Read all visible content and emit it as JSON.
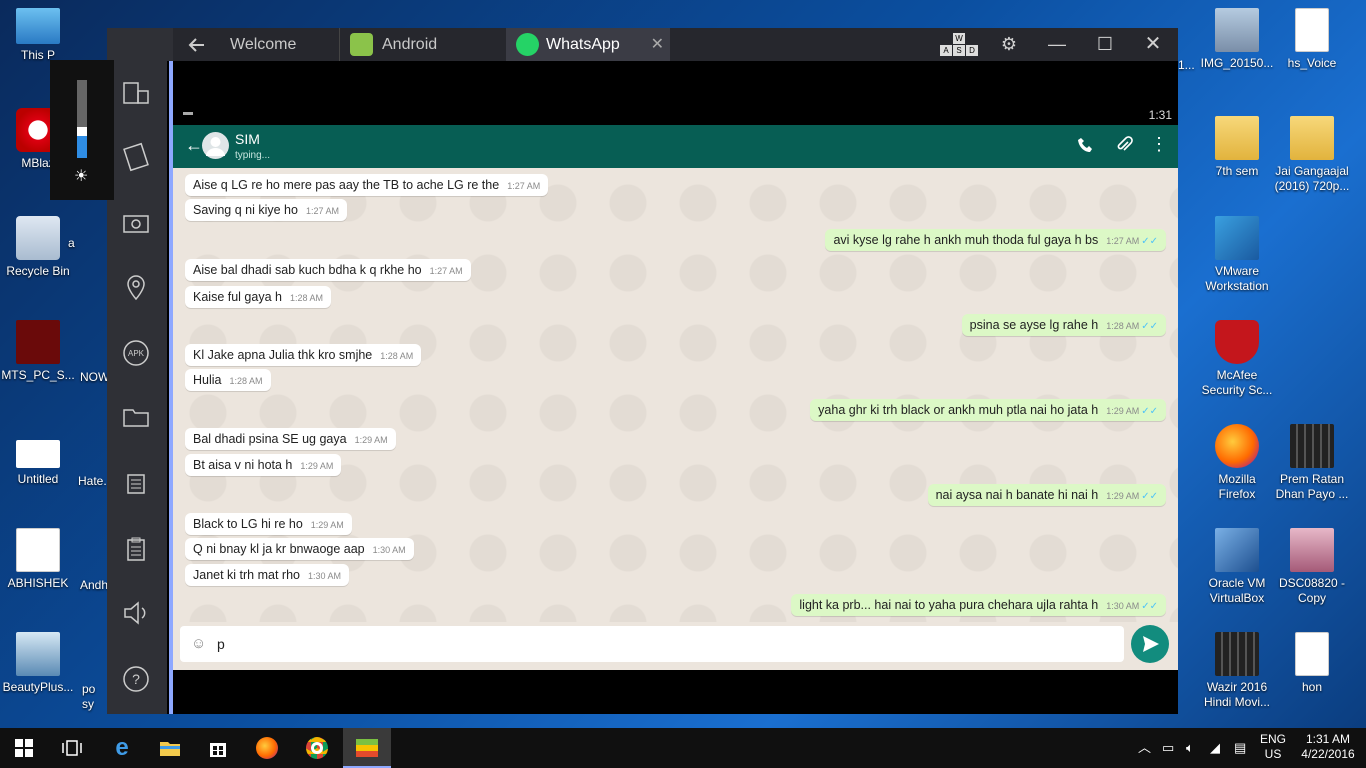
{
  "desktop": {
    "left_icons": [
      {
        "label": "This P",
        "icon": "computer-icon"
      },
      {
        "label": "MBlaz",
        "icon": "mblaze-icon"
      },
      {
        "label": "Recycle Bin",
        "icon": "recycle-bin-icon"
      },
      {
        "label": "MTS_PC_S...",
        "icon": "mts-icon"
      },
      {
        "label": "Untitled",
        "icon": "image-icon"
      },
      {
        "label": "ABHISHEK",
        "icon": "document-icon"
      },
      {
        "label": "BeautyPlus...",
        "icon": "photo-icon"
      }
    ],
    "col2_icons": [
      {
        "label": "a"
      },
      {
        "label": "NOW"
      },
      {
        "label": "Hate."
      },
      {
        "label": "Andh"
      },
      {
        "label": "po sy"
      }
    ],
    "right_col1": [
      {
        "label": "IMG_20150...",
        "icon": "photo-icon"
      },
      {
        "label": "7th sem",
        "icon": "folder-icon"
      },
      {
        "label": "VMware Workstation",
        "icon": "vmware-icon"
      },
      {
        "label": "McAfee Security Sc...",
        "icon": "mcafee-icon"
      },
      {
        "label": "Mozilla Firefox",
        "icon": "firefox-icon"
      },
      {
        "label": "Oracle VM VirtualBox",
        "icon": "virtualbox-icon"
      },
      {
        "label": "Wazir 2016 Hindi Movi...",
        "icon": "video-icon"
      }
    ],
    "right_col2": [
      {
        "label": "hs_Voice",
        "icon": "document-icon"
      },
      {
        "label": "Jai Gangaajal (2016) 720p...",
        "icon": "folder-icon"
      },
      {
        "label": "Prem Ratan Dhan Payo ...",
        "icon": "video-icon"
      },
      {
        "label": "DSC08820 - Copy",
        "icon": "photo-icon"
      },
      {
        "label": "hon",
        "icon": "document-icon"
      }
    ],
    "partial_label": "1..."
  },
  "bluestacks": {
    "tabs": [
      {
        "label": "Welcome"
      },
      {
        "label": "Android"
      },
      {
        "label": "WhatsApp"
      }
    ],
    "keyboard_keys": [
      "W",
      "A",
      "S",
      "D"
    ]
  },
  "android": {
    "time": "1:31",
    "contact_name": "SIM",
    "contact_status": "typing...",
    "input_value": "p",
    "messages": [
      {
        "text": "Aise q LG re ho mere pas aay the TB to ache LG re the",
        "time": "1:27 AM",
        "dir": "in"
      },
      {
        "text": "Saving  q ni kiye ho",
        "time": "1:27 AM",
        "dir": "in"
      },
      {
        "text": "avi kyse lg rahe h ankh muh thoda ful gaya h bs",
        "time": "1:27 AM",
        "dir": "out"
      },
      {
        "text": "Aise bal dhadi sab kuch bdha k q rkhe ho",
        "time": "1:27 AM",
        "dir": "in"
      },
      {
        "text": "Kaise ful gaya h",
        "time": "1:28 AM",
        "dir": "in"
      },
      {
        "text": "psina se ayse lg rahe h",
        "time": "1:28 AM",
        "dir": "out"
      },
      {
        "text": "Kl Jake apna Julia thk kro smjhe",
        "time": "1:28 AM",
        "dir": "in"
      },
      {
        "text": "Hulia",
        "time": "1:28 AM",
        "dir": "in"
      },
      {
        "text": "yaha ghr ki trh black or  ankh muh ptla nai ho jata h",
        "time": "1:29 AM",
        "dir": "out"
      },
      {
        "text": "Bal dhadi psina SE ug gaya",
        "time": "1:29 AM",
        "dir": "in"
      },
      {
        "text": "Bt aisa v ni hota h",
        "time": "1:29 AM",
        "dir": "in"
      },
      {
        "text": "nai  aysa nai h banate hi nai h",
        "time": "1:29 AM",
        "dir": "out"
      },
      {
        "text": "Black to LG hi re ho",
        "time": "1:29 AM",
        "dir": "in"
      },
      {
        "text": "Q ni bnay kl ja kr bnwaoge aap",
        "time": "1:30 AM",
        "dir": "in"
      },
      {
        "text": "Janet ki trh mat rho",
        "time": "1:30 AM",
        "dir": "in"
      },
      {
        "text": "light ka prb... hai  nai to yaha pura chehara ujla rahta h",
        "time": "1:30 AM",
        "dir": "out"
      }
    ]
  },
  "taskbar": {
    "language": "ENG",
    "region": "US",
    "clock_time": "1:31 AM",
    "clock_date": "4/22/2016"
  },
  "colors": {
    "whatsapp_header": "#075e54",
    "outgoing_bubble": "#dcf8c6",
    "send_button": "#128c7e",
    "bluestacks_accent": "#8ea8ff"
  }
}
